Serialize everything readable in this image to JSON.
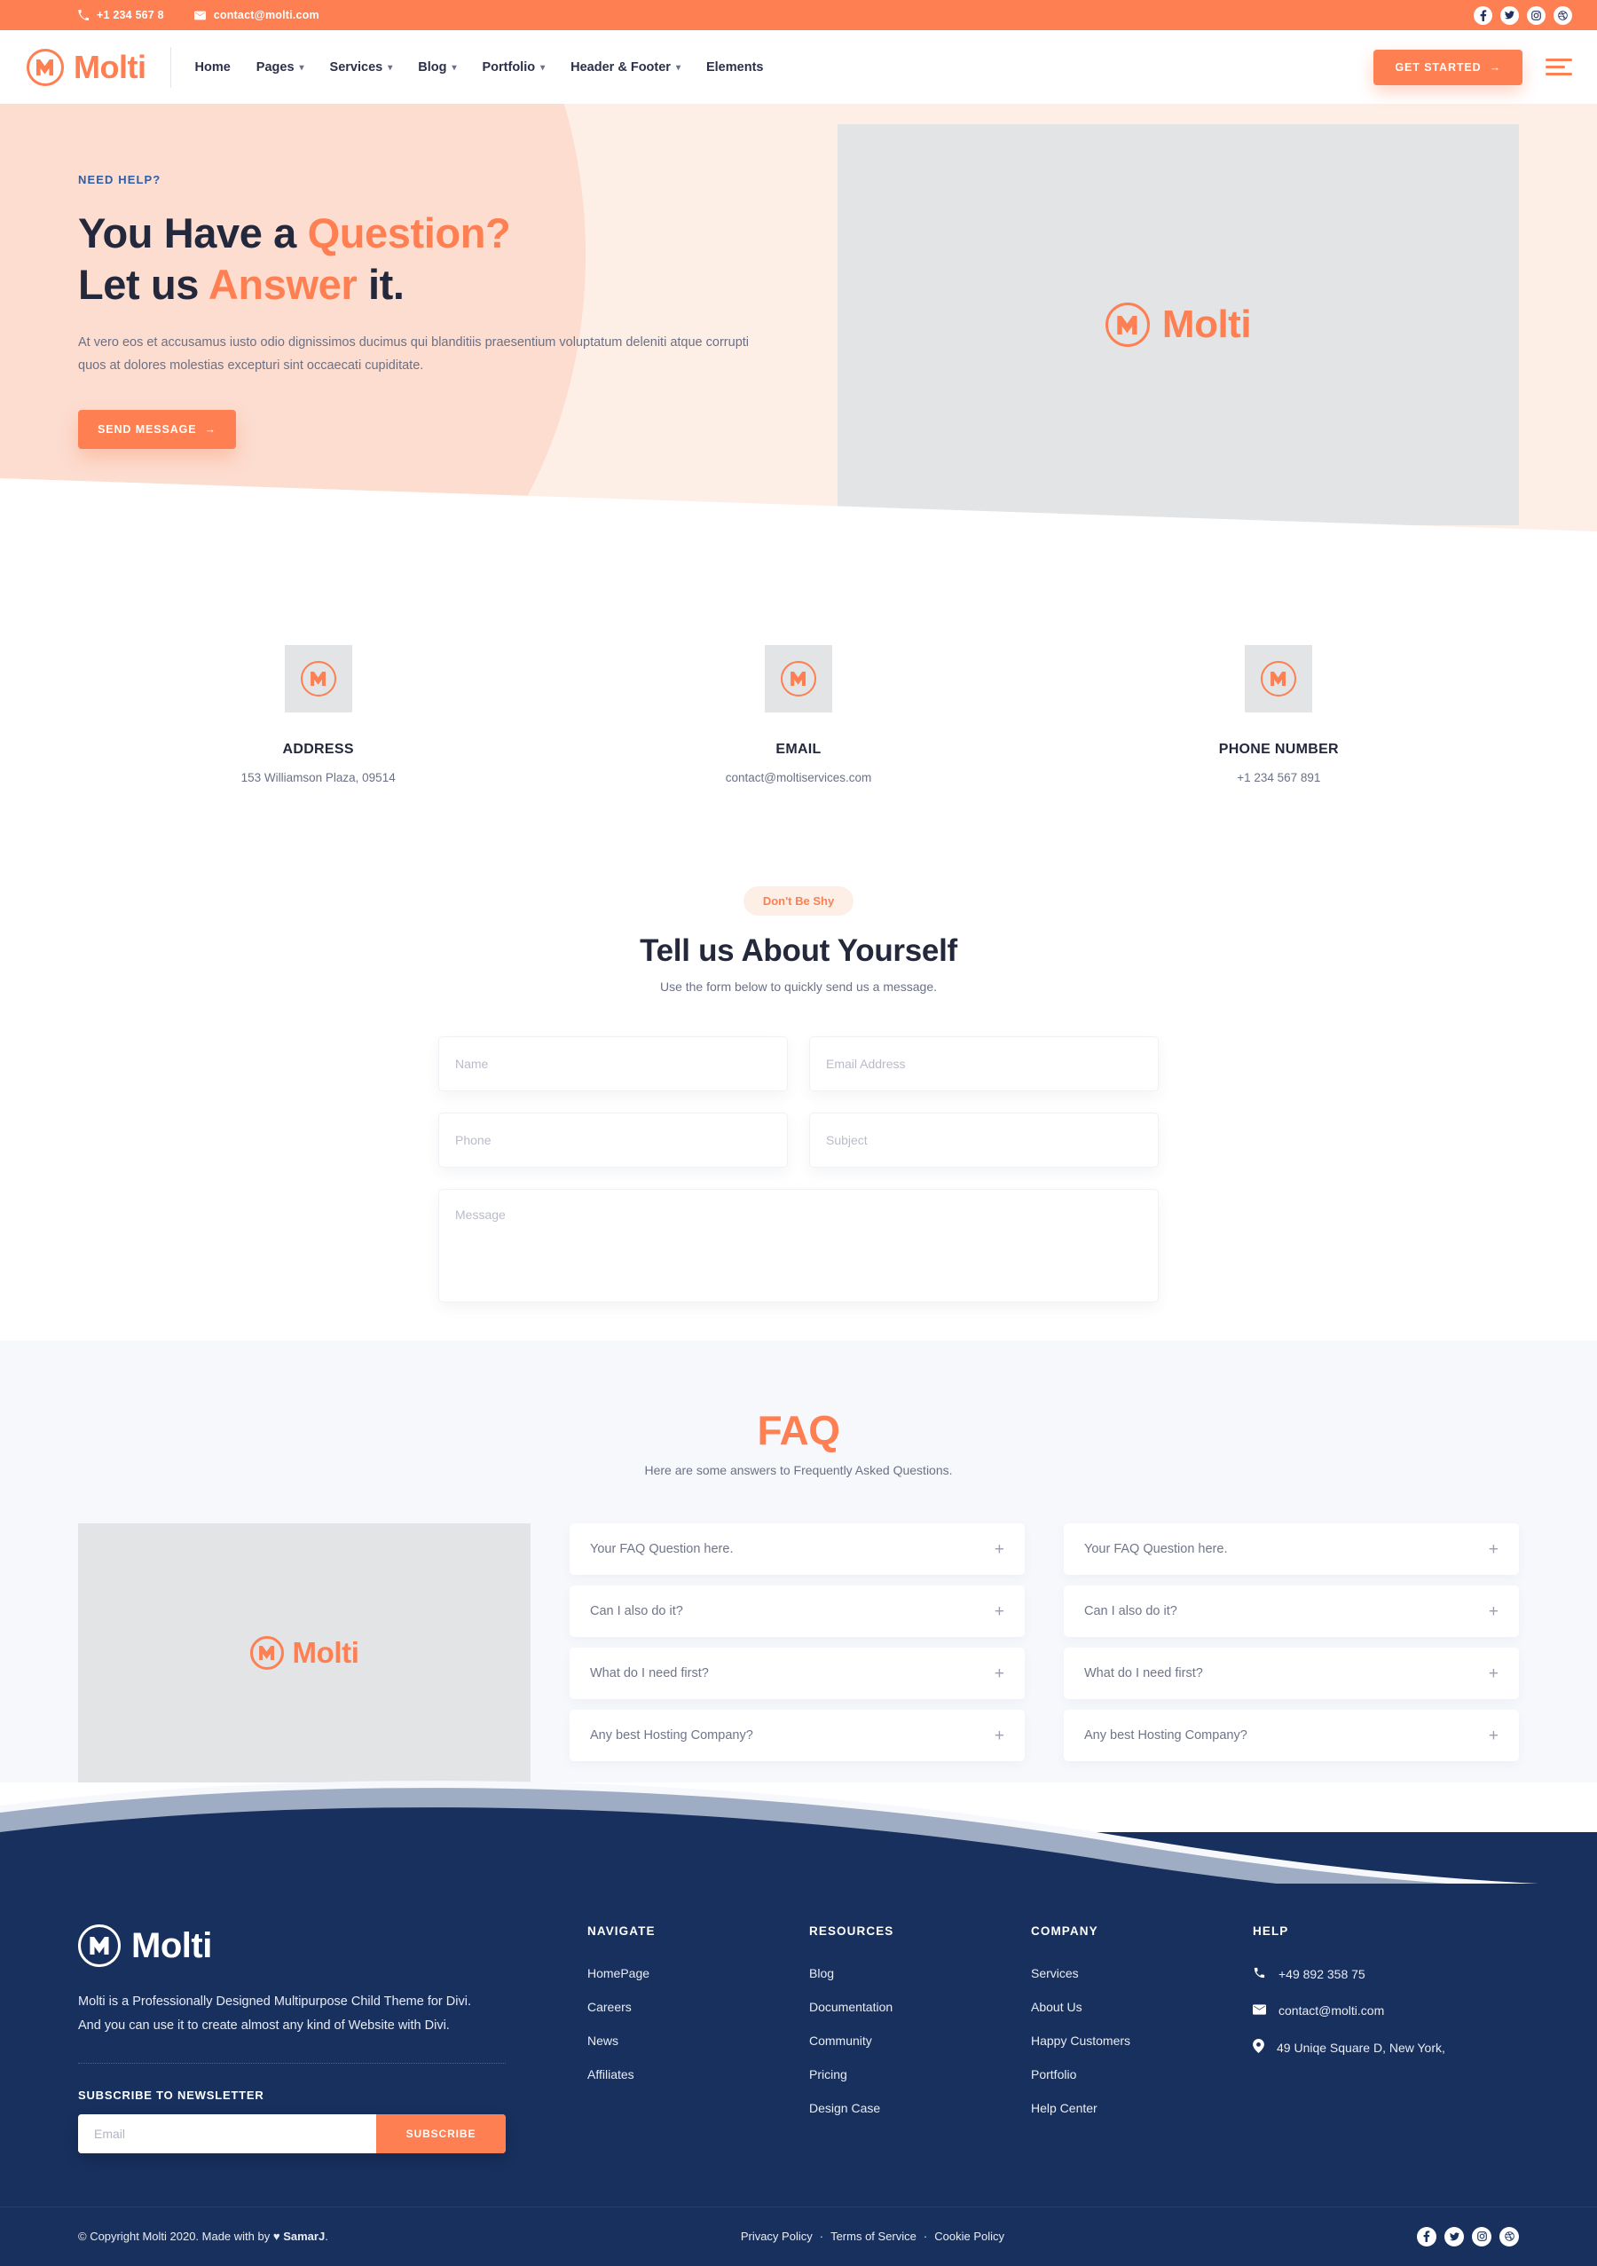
{
  "topbar": {
    "phone": "+1 234 567 8",
    "email": "contact@molti.com",
    "socials": [
      "facebook-icon",
      "twitter-icon",
      "instagram-icon",
      "dribbble-icon"
    ]
  },
  "nav": {
    "brand": "Molti",
    "links": [
      {
        "label": "Home",
        "caret": false
      },
      {
        "label": "Pages",
        "caret": true
      },
      {
        "label": "Services",
        "caret": true
      },
      {
        "label": "Blog",
        "caret": true
      },
      {
        "label": "Portfolio",
        "caret": true
      },
      {
        "label": "Header & Footer",
        "caret": true
      },
      {
        "label": "Elements",
        "caret": false
      }
    ],
    "cta": "GET STARTED",
    "cta_arrow": "→"
  },
  "hero": {
    "eyebrow": "NEED HELP?",
    "h1_line1_a": "You Have a ",
    "h1_line1_b": "Question?",
    "h1_line2_a": "Let us ",
    "h1_line2_b": "Answer",
    "h1_line2_c": " it.",
    "paragraph": "At vero eos et accusamus iusto odio dignissimos ducimus qui blanditiis praesentium voluptatum deleniti atque corrupti quos at dolores molestias excepturi sint occaecati cupiditate.",
    "button": "SEND MESSAGE",
    "button_arrow": "→",
    "image_logo": "Molti"
  },
  "contact_cards": [
    {
      "icon": "molti-logo-icon",
      "title": "ADDRESS",
      "value": "153 Williamson Plaza, 09514"
    },
    {
      "icon": "molti-logo-icon",
      "title": "EMAIL",
      "value": "contact@moltiservices.com"
    },
    {
      "icon": "molti-logo-icon",
      "title": "PHONE NUMBER",
      "value": "+1 234 567 891"
    }
  ],
  "form": {
    "pill": "Don't Be Shy",
    "heading": "Tell us About Yourself",
    "subheading": "Use the form below to quickly send us a message.",
    "name_placeholder": "Name",
    "email_placeholder": "Email Address",
    "phone_placeholder": "Phone",
    "subject_placeholder": "Subject",
    "message_placeholder": "Message"
  },
  "faq": {
    "heading": "FAQ",
    "subheading": "Here are some answers to Frequently Asked Questions.",
    "image_logo": "Molti",
    "plus": "+",
    "left_items": [
      "Your FAQ Question here.",
      "Can I also do it?",
      "What do I need first?",
      "Any best Hosting Company?"
    ],
    "right_items": [
      "Your FAQ Question here.",
      "Can I also do it?",
      "What do I need first?",
      "Any best Hosting Company?"
    ]
  },
  "footer": {
    "brand": "Molti",
    "description": "Molti is a Professionally Designed  Multipurpose Child Theme for Divi. And you can use it to create almost any kind of Website with Divi.",
    "subscribe_title": "SUBSCRIBE TO NEWSLETTER",
    "subscribe_placeholder": "Email",
    "subscribe_button": "SUBSCRIBE",
    "columns": [
      {
        "title": "NAVIGATE",
        "items": [
          "HomePage",
          "Careers",
          "News",
          "Affiliates"
        ]
      },
      {
        "title": "RESOURCES",
        "items": [
          "Blog",
          "Documentation",
          "Community",
          "Pricing",
          "Design Case"
        ]
      },
      {
        "title": "COMPANY",
        "items": [
          "Services",
          "About Us",
          "Happy Customers",
          "Portfolio",
          "Help Center"
        ]
      }
    ],
    "help": {
      "title": "HELP",
      "rows": [
        {
          "icon": "phone-icon",
          "text": "+49 892 358 75"
        },
        {
          "icon": "envelope-icon",
          "text": "contact@molti.com"
        },
        {
          "icon": "location-pin-icon",
          "text": "49 Uniqe Square D, New York,"
        }
      ]
    },
    "bottom": {
      "copyright_pre": "© Copyright Molti 2020. Made with by ",
      "heart": "♥",
      "copyright_author": "SamarJ",
      "copyright_post": ".",
      "links": [
        "Privacy Policy",
        "Terms of Service",
        "Cookie Policy"
      ],
      "separator": "·",
      "socials": [
        "facebook-icon",
        "twitter-icon",
        "instagram-icon",
        "dribbble-icon"
      ]
    }
  },
  "colors": {
    "accent": "#fd7f52",
    "hero_bg": "#fdeee6",
    "hero_blob": "#fcddd0",
    "footer_bg": "#18305e",
    "faq_bg": "#f6f8fc",
    "heading": "#24283c",
    "body_text": "#6b7085",
    "eyebrow_blue": "#2f5ea8",
    "placeholder_gray": "#e3e4e6"
  }
}
